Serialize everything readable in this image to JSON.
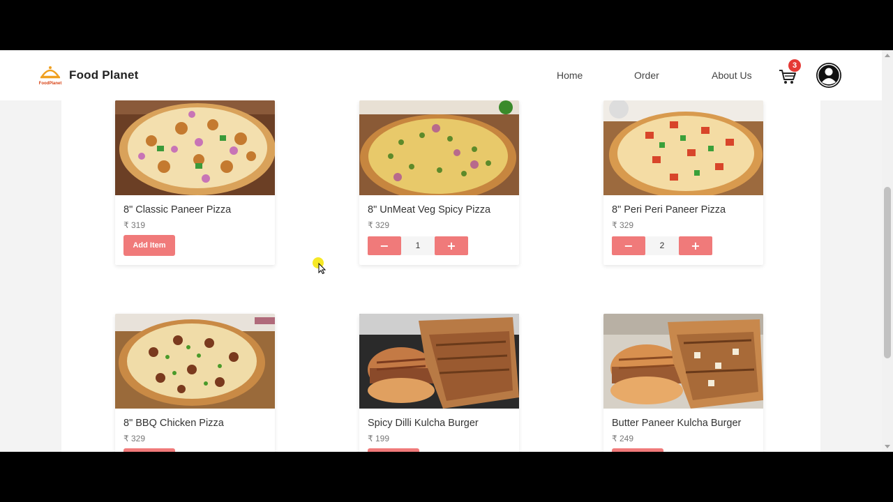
{
  "app": {
    "brand_name": "Food Planet",
    "logo_text": "FoodPlanet",
    "accent_color": "#f07a7a",
    "badge_color": "#e53935"
  },
  "nav": {
    "links": [
      "Home",
      "Order",
      "About Us"
    ],
    "cart_icon": "cart-icon",
    "cart_count": "3",
    "profile_icon": "user-avatar-icon"
  },
  "menu": {
    "currency": "₹",
    "add_label": "Add Item",
    "minus_label": "−",
    "plus_label": "+",
    "items": [
      {
        "name": "8\" Classic Paneer Pizza",
        "price": "₹ 319",
        "quantity": 0
      },
      {
        "name": "8\" UnMeat Veg Spicy Pizza",
        "price": "₹ 329",
        "quantity": 1,
        "qty_label": "1"
      },
      {
        "name": "8\" Peri Peri Paneer Pizza",
        "price": "₹ 329",
        "quantity": 2,
        "qty_label": "2"
      },
      {
        "name": "8\" BBQ Chicken Pizza",
        "price": "₹ 329",
        "quantity": 0
      },
      {
        "name": "Spicy Dilli Kulcha Burger",
        "price": "₹ 199",
        "quantity": 0
      },
      {
        "name": "Butter Paneer Kulcha Burger",
        "price": "₹ 249",
        "quantity": 0
      }
    ]
  }
}
